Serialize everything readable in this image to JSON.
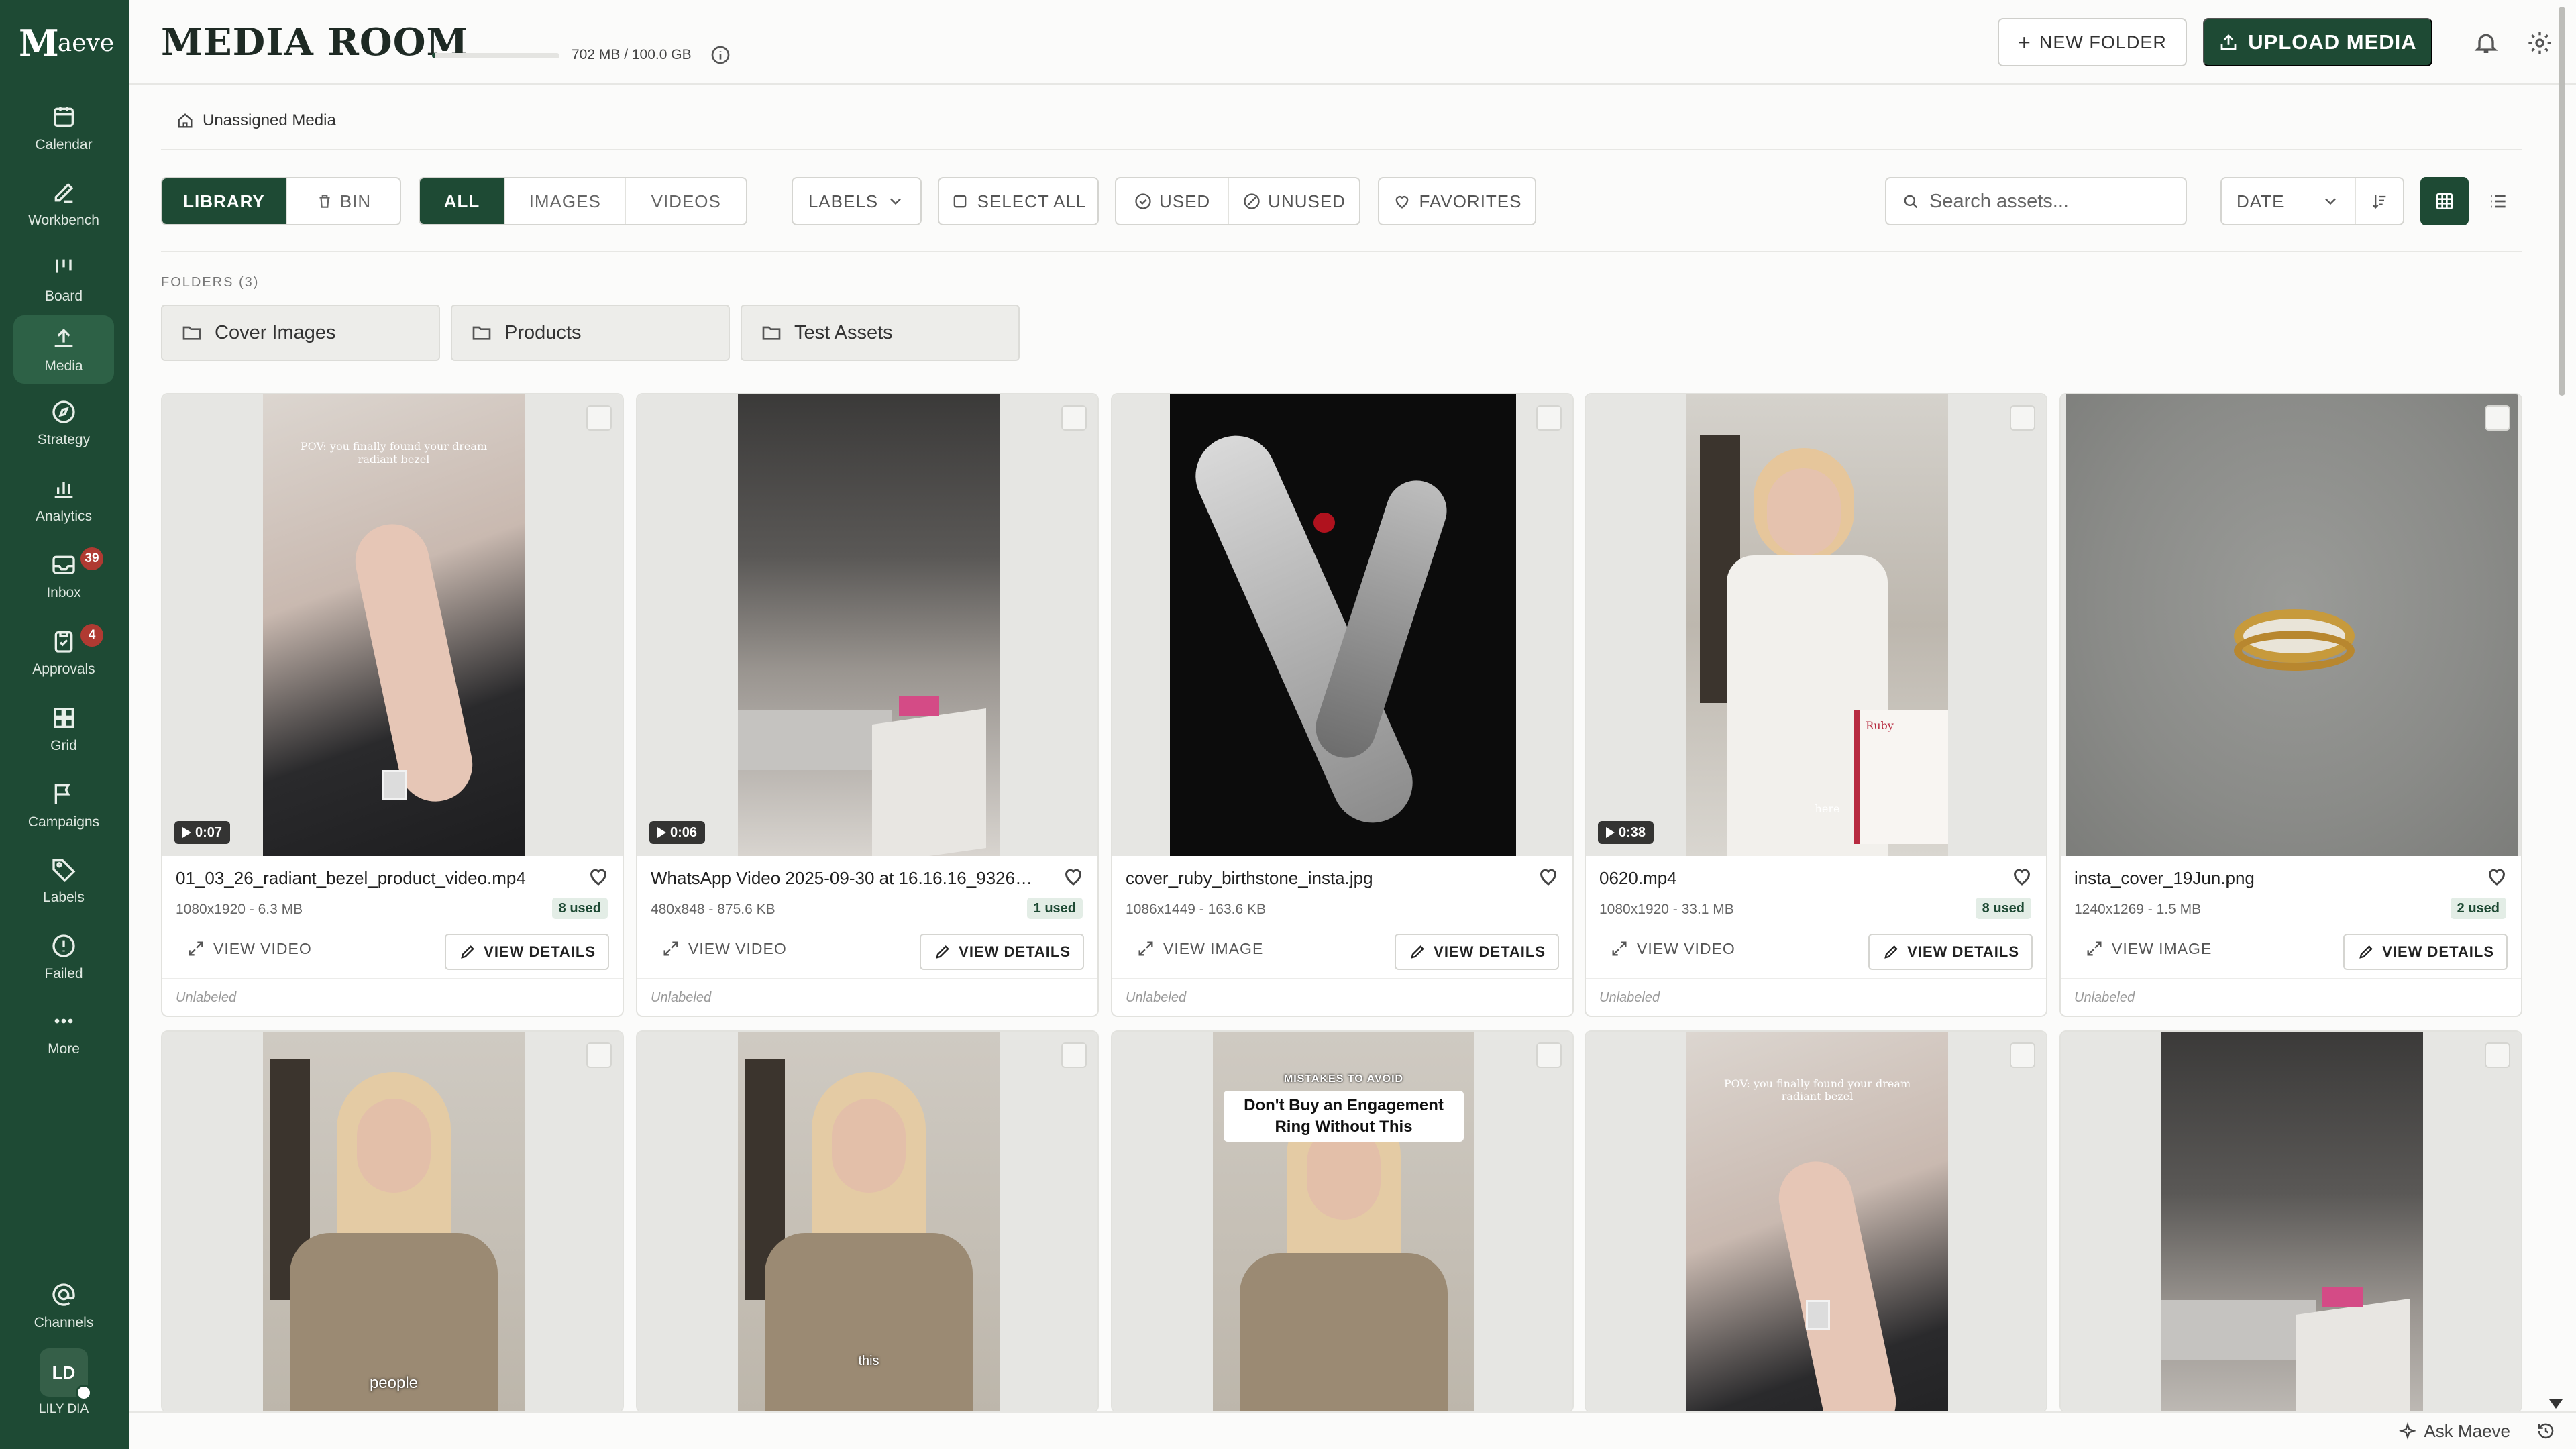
{
  "brand": {
    "logo_mark": "M",
    "logo_text": "aeve"
  },
  "sidebar": {
    "items": [
      {
        "label": "Calendar",
        "icon": "calendar-icon"
      },
      {
        "label": "Workbench",
        "icon": "edit-icon"
      },
      {
        "label": "Board",
        "icon": "board-icon"
      },
      {
        "label": "Media",
        "icon": "upload-icon",
        "active": true
      },
      {
        "label": "Strategy",
        "icon": "compass-icon"
      },
      {
        "label": "Analytics",
        "icon": "bar-chart-icon"
      },
      {
        "label": "Inbox",
        "icon": "inbox-icon",
        "badge": "39"
      },
      {
        "label": "Approvals",
        "icon": "clipboard-icon",
        "badge": "4"
      },
      {
        "label": "Grid",
        "icon": "grid-icon"
      },
      {
        "label": "Campaigns",
        "icon": "flag-icon"
      },
      {
        "label": "Labels",
        "icon": "tag-icon"
      },
      {
        "label": "Failed",
        "icon": "alert-icon"
      },
      {
        "label": "More",
        "icon": "more-icon"
      },
      {
        "label": "Channels",
        "icon": "at-icon"
      }
    ],
    "user": {
      "initials": "LD",
      "name": "LILY DIA"
    }
  },
  "header": {
    "title": "MEDIA ROOM",
    "storage_text": "702 MB / 100.0 GB",
    "storage_fraction": 0.007,
    "new_folder_label": "NEW FOLDER",
    "upload_label": "UPLOAD MEDIA"
  },
  "breadcrumb": {
    "label": "Unassigned Media"
  },
  "toolbar": {
    "library": "LIBRARY",
    "bin": "BIN",
    "filter_all": "ALL",
    "filter_images": "IMAGES",
    "filter_videos": "VIDEOS",
    "labels": "LABELS",
    "select_all": "SELECT ALL",
    "used": "USED",
    "unused": "UNUSED",
    "favorites": "FAVORITES",
    "search_placeholder": "Search assets...",
    "sort_value": "DATE"
  },
  "folders": {
    "heading": "FOLDERS (3)",
    "items": [
      "Cover Images",
      "Products",
      "Test Assets"
    ]
  },
  "assets": [
    {
      "name": "01_03_26_radiant_bezel_product_video.mp4",
      "meta": "1080x1920 - 6.3 MB",
      "used": "8 used",
      "duration": "0:07",
      "action": "VIEW VIDEO",
      "details": "VIEW DETAILS",
      "label": "Unlabeled",
      "caption": "POV: you finally found your dream radiant bezel"
    },
    {
      "name": "WhatsApp Video 2025-09-30 at 16.16.16_93268f8...",
      "meta": "480x848 - 875.6 KB",
      "used": "1 used",
      "duration": "0:06",
      "action": "VIEW VIDEO",
      "details": "VIEW DETAILS",
      "label": "Unlabeled"
    },
    {
      "name": "cover_ruby_birthstone_insta.jpg",
      "meta": "1086x1449 - 163.6 KB",
      "used": "",
      "duration": "",
      "action": "VIEW IMAGE",
      "details": "VIEW DETAILS",
      "label": "Unlabeled"
    },
    {
      "name": "0620.mp4",
      "meta": "1080x1920 - 33.1 MB",
      "used": "8 used",
      "duration": "0:38",
      "action": "VIEW VIDEO",
      "details": "VIEW DETAILS",
      "label": "Unlabeled",
      "caption": "Ruby",
      "caption2": "here"
    },
    {
      "name": "insta_cover_19Jun.png",
      "meta": "1240x1269 - 1.5 MB",
      "used": "2 used",
      "duration": "",
      "action": "VIEW IMAGE",
      "details": "VIEW DETAILS",
      "label": "Unlabeled"
    }
  ],
  "assets_row2": [
    {
      "caption": "people"
    },
    {
      "caption": "this"
    },
    {
      "caption_top": "MISTAKES TO AVOID",
      "caption_main": "Don't Buy an Engagement Ring Without This"
    },
    {
      "caption": "POV: you finally found your dream radiant bezel"
    },
    {
      "caption": ""
    }
  ],
  "footer": {
    "ask_label": "Ask Maeve"
  },
  "colors": {
    "brand": "#1e4a34",
    "badge": "#b03a32"
  }
}
